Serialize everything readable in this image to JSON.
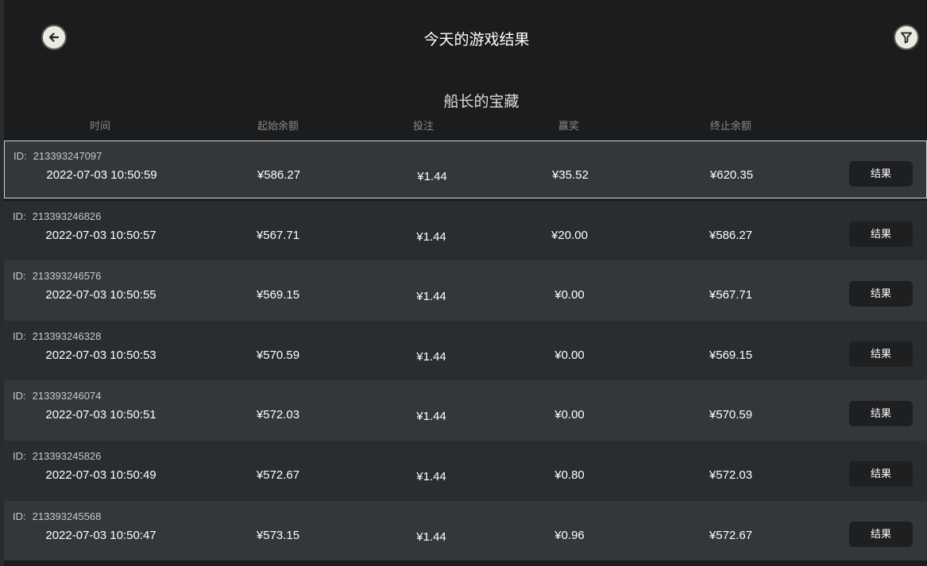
{
  "header": {
    "title": "今天的游戏结果",
    "back_icon": "arrow-left-icon",
    "filter_icon": "filter-funnel-icon"
  },
  "game": {
    "title": "船长的宝藏"
  },
  "columns": {
    "time": "时间",
    "start_balance": "起始余额",
    "bet": "投注",
    "win": "赢奖",
    "end_balance": "终止余额"
  },
  "rows": [
    {
      "id_label": "ID:",
      "id": "213393247097",
      "time": "2022-07-03 10:50:59",
      "start": "¥586.27",
      "bet": "¥1.44",
      "win": "¥35.52",
      "end": "¥620.35",
      "button": "结果"
    },
    {
      "id_label": "ID:",
      "id": "213393246826",
      "time": "2022-07-03 10:50:57",
      "start": "¥567.71",
      "bet": "¥1.44",
      "win": "¥20.00",
      "end": "¥586.27",
      "button": "结果"
    },
    {
      "id_label": "ID:",
      "id": "213393246576",
      "time": "2022-07-03 10:50:55",
      "start": "¥569.15",
      "bet": "¥1.44",
      "win": "¥0.00",
      "end": "¥567.71",
      "button": "结果"
    },
    {
      "id_label": "ID:",
      "id": "213393246328",
      "time": "2022-07-03 10:50:53",
      "start": "¥570.59",
      "bet": "¥1.44",
      "win": "¥0.00",
      "end": "¥569.15",
      "button": "结果"
    },
    {
      "id_label": "ID:",
      "id": "213393246074",
      "time": "2022-07-03 10:50:51",
      "start": "¥572.03",
      "bet": "¥1.44",
      "win": "¥0.00",
      "end": "¥570.59",
      "button": "结果"
    },
    {
      "id_label": "ID:",
      "id": "213393245826",
      "time": "2022-07-03 10:50:49",
      "start": "¥572.67",
      "bet": "¥1.44",
      "win": "¥0.80",
      "end": "¥572.03",
      "button": "结果"
    },
    {
      "id_label": "ID:",
      "id": "213393245568",
      "time": "2022-07-03 10:50:47",
      "start": "¥573.15",
      "bet": "¥1.44",
      "win": "¥0.96",
      "end": "¥572.67",
      "button": "结果"
    }
  ],
  "colors": {
    "background": "#1b1c1e",
    "row_odd": "#33373a",
    "row_even": "#2a2d2f",
    "button_bg": "#1e1f21",
    "icon_bg": "#ecebdf"
  }
}
